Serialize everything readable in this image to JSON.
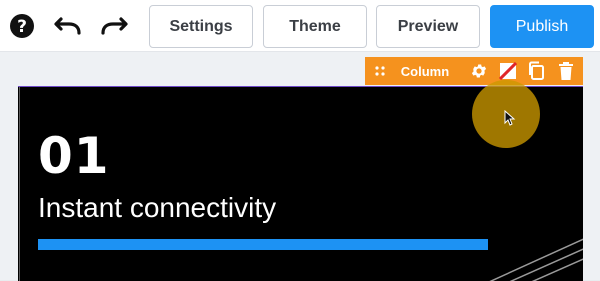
{
  "toolbar": {
    "help_icon": "question-circle-icon",
    "undo_icon": "undo-icon",
    "redo_icon": "redo-icon",
    "settings_label": "Settings",
    "theme_label": "Theme",
    "preview_label": "Preview",
    "publish_label": "Publish"
  },
  "column_toolbar": {
    "label": "Column",
    "drag_icon": "drag-handle-icon",
    "settings_icon": "gear-icon",
    "background_icon": "no-fill-icon",
    "duplicate_icon": "copy-icon",
    "delete_icon": "trash-icon"
  },
  "content": {
    "number": "01",
    "subtitle": "Instant connectivity",
    "progress_fraction": 1.0
  },
  "colors": {
    "accent": "#1d92f3",
    "column_toolbar": "#f5921e",
    "canvas_bg": "#000000",
    "cursor_halo": "#cc9900"
  }
}
